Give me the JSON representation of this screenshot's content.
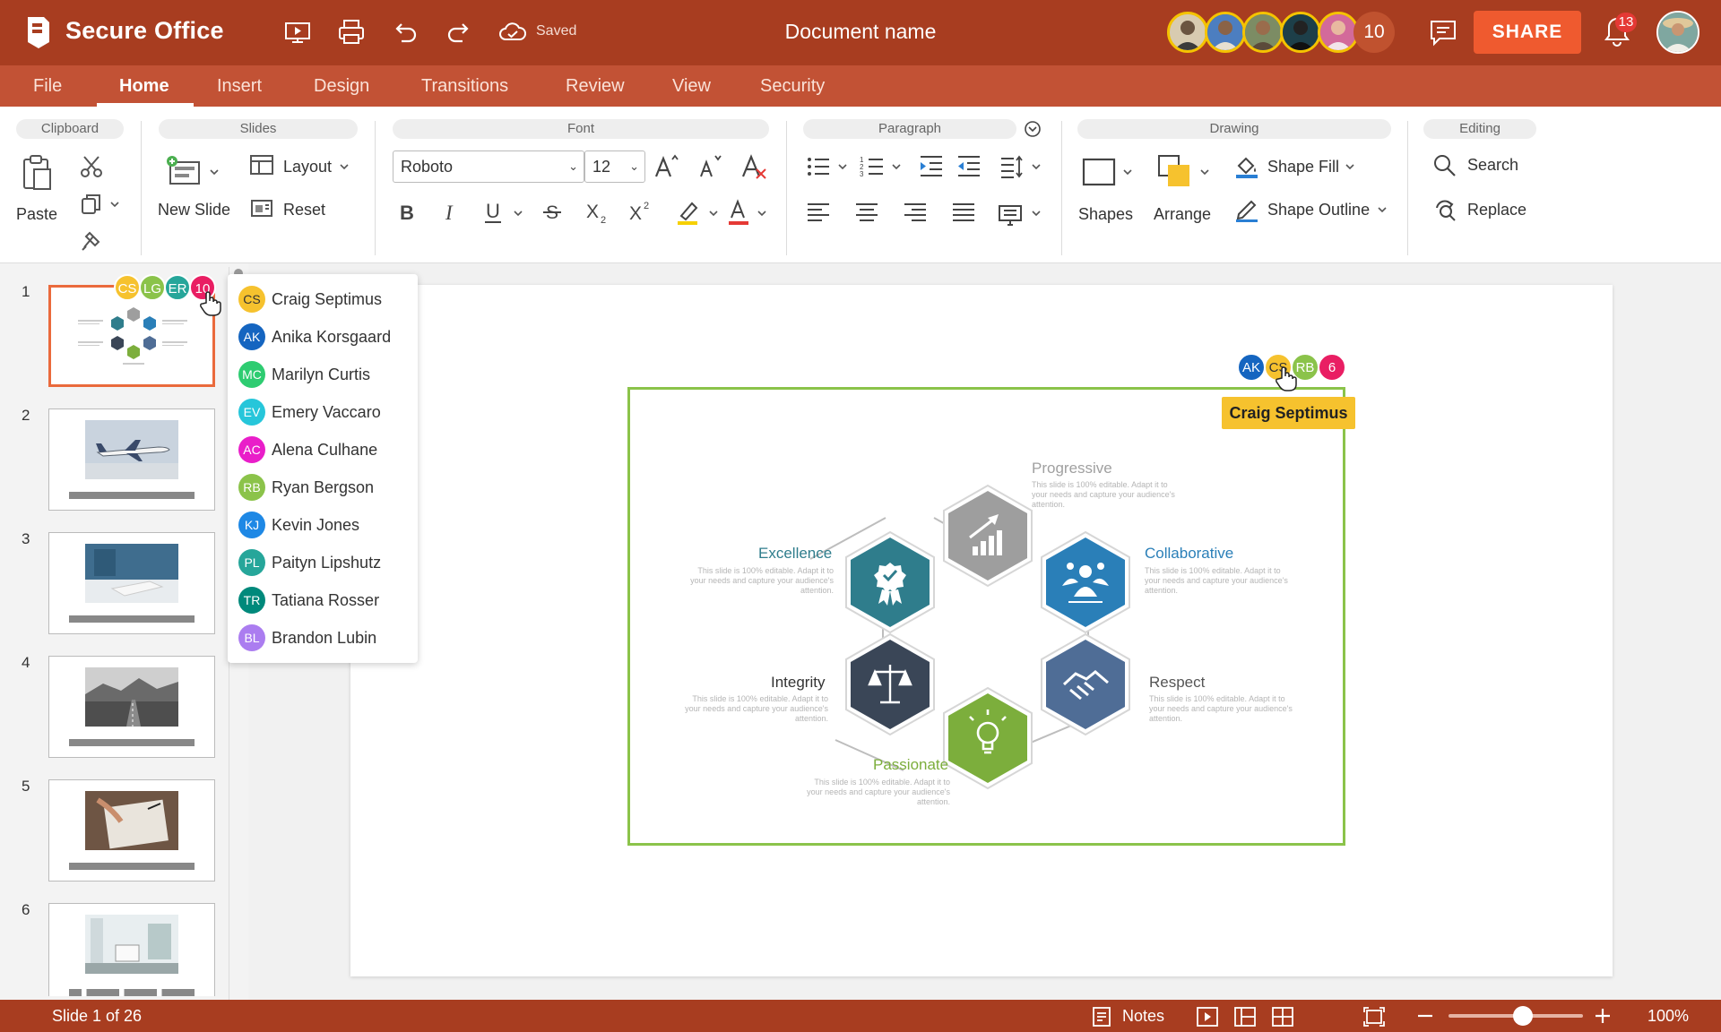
{
  "app": {
    "name": "Secure Office",
    "saved_label": "Saved",
    "document_name": "Document name"
  },
  "colors": {
    "titlebar": "#a83d20",
    "menubar": "#c25235",
    "share": "#ef5a2f",
    "selection": "#8bc34a",
    "thumb_selected": "#ea6a3c"
  },
  "header": {
    "collaborator_count": "10",
    "share_label": "SHARE",
    "notification_count": "13"
  },
  "menu": {
    "items": [
      "File",
      "Home",
      "Insert",
      "Design",
      "Transitions",
      "Review",
      "View",
      "Security"
    ],
    "active": "Home"
  },
  "ribbon": {
    "clipboard": {
      "title": "Clipboard",
      "paste": "Paste"
    },
    "slides": {
      "title": "Slides",
      "new_slide": "New Slide",
      "layout": "Layout",
      "reset": "Reset"
    },
    "font": {
      "title": "Font",
      "family": "Roboto",
      "size": "12"
    },
    "paragraph": {
      "title": "Paragraph"
    },
    "drawing": {
      "title": "Drawing",
      "shapes": "Shapes",
      "arrange": "Arrange",
      "shape_fill": "Shape Fill",
      "shape_outline": "Shape Outline"
    },
    "editing": {
      "title": "Editing",
      "search": "Search",
      "replace": "Replace"
    }
  },
  "thumbnails": {
    "numbers": [
      "1",
      "2",
      "3",
      "4",
      "5",
      "6"
    ],
    "slide1_collaborators": [
      {
        "initials": "CS",
        "color": "#f6c22e"
      },
      {
        "initials": "LG",
        "color": "#8bc34a"
      },
      {
        "initials": "ER",
        "color": "#26a69a"
      },
      {
        "initials": "10",
        "color": "#e91e63"
      }
    ]
  },
  "collaborator_list": [
    {
      "initials": "CS",
      "name": "Craig Septimus",
      "color": "#f6c22e"
    },
    {
      "initials": "AK",
      "name": "Anika Korsgaard",
      "color": "#1565c0"
    },
    {
      "initials": "MC",
      "name": "Marilyn Curtis",
      "color": "#2ecc71"
    },
    {
      "initials": "EV",
      "name": "Emery Vaccaro",
      "color": "#26c6da"
    },
    {
      "initials": "AC",
      "name": "Alena Culhane",
      "color": "#e91ec9"
    },
    {
      "initials": "RB",
      "name": "Ryan Bergson",
      "color": "#8bc34a"
    },
    {
      "initials": "KJ",
      "name": "Kevin Jones",
      "color": "#1e88e5"
    },
    {
      "initials": "PL",
      "name": "Paityn Lipshutz",
      "color": "#26a69a"
    },
    {
      "initials": "TR",
      "name": "Tatiana Rosser",
      "color": "#00897b"
    },
    {
      "initials": "BL",
      "name": "Brandon Lubin",
      "color": "#ab7df0"
    }
  ],
  "canvas": {
    "collaborators": [
      {
        "initials": "AK",
        "color": "#1565c0"
      },
      {
        "initials": "CS",
        "color": "#f6c22e"
      },
      {
        "initials": "RB",
        "color": "#8bc34a"
      },
      {
        "initials": "6",
        "color": "#e91e63"
      }
    ],
    "cursor_tag": "Craig Septimus"
  },
  "diagram": {
    "description_text": "This slide is 100% editable. Adapt it to your needs and capture your audience's attention.",
    "nodes": [
      {
        "title": "Progressive",
        "color": "#9e9e9e",
        "icon": "chart-growth-icon"
      },
      {
        "title": "Collaborative",
        "color": "#2a7fb8",
        "icon": "team-icon"
      },
      {
        "title": "Respect",
        "color": "#4f6d96",
        "icon": "handshake-icon"
      },
      {
        "title": "Passionate",
        "color": "#7cae3c",
        "icon": "lightbulb-icon"
      },
      {
        "title": "Integrity",
        "color": "#3a4657",
        "icon": "scales-icon"
      },
      {
        "title": "Excellence",
        "color": "#2f7d8c",
        "icon": "award-icon"
      }
    ]
  },
  "status": {
    "slide_info": "Slide 1 of 26",
    "notes_label": "Notes",
    "zoom": "100%",
    "zoom_fraction": 0.55
  }
}
